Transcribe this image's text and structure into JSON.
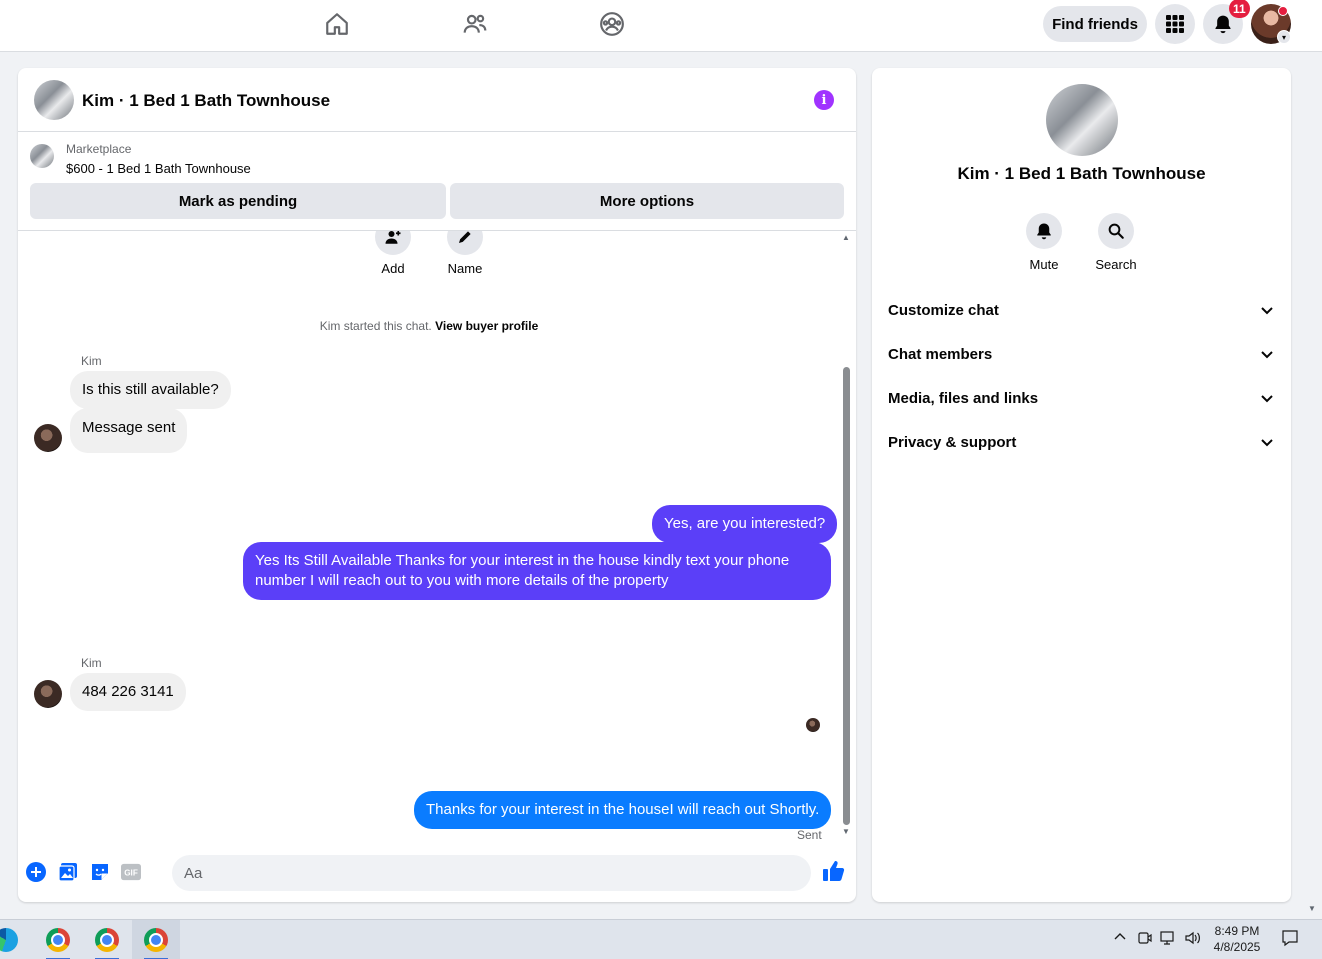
{
  "topbar": {
    "find_friends_label": "Find friends",
    "notification_count": "11"
  },
  "chat": {
    "title": "Kim · 1 Bed 1 Bath Townhouse",
    "marketplace_label": "Marketplace",
    "listing_price_title": "$600 - 1 Bed 1 Bath Townhouse",
    "mark_pending_label": "Mark as pending",
    "more_options_label": "More options",
    "add_label": "Add",
    "name_label": "Name",
    "started_text": "Kim started this chat.",
    "view_buyer_profile": "View buyer profile",
    "messages": [
      {
        "sender": "Kim",
        "direction": "in",
        "text": "Is this still available?"
      },
      {
        "direction": "in",
        "text": "Message sent"
      },
      {
        "direction": "out",
        "text": "Yes, are you interested?"
      },
      {
        "direction": "out",
        "text": "Yes Its Still Available Thanks for your interest in the house kindly text your phone number I will reach out to you with more details of the property"
      },
      {
        "sender": "Kim",
        "direction": "in",
        "text": "484 226 3141"
      },
      {
        "direction": "out",
        "text": "Thanks for your interest in the houseI will reach out Shortly."
      }
    ],
    "sent_status": "Sent",
    "composer_placeholder": "Aa"
  },
  "details": {
    "title": "Kim · 1 Bed 1 Bath Townhouse",
    "mute_label": "Mute",
    "search_label": "Search",
    "sections": [
      "Customize chat",
      "Chat members",
      "Media, files and links",
      "Privacy & support"
    ]
  },
  "taskbar": {
    "time": "8:49 PM",
    "date": "4/8/2025"
  },
  "colors": {
    "outgoing_bubble": "#5b3ff8",
    "last_outgoing_bubble": "#0a7cff",
    "accent": "#0866ff",
    "info_icon": "#a033ff"
  }
}
